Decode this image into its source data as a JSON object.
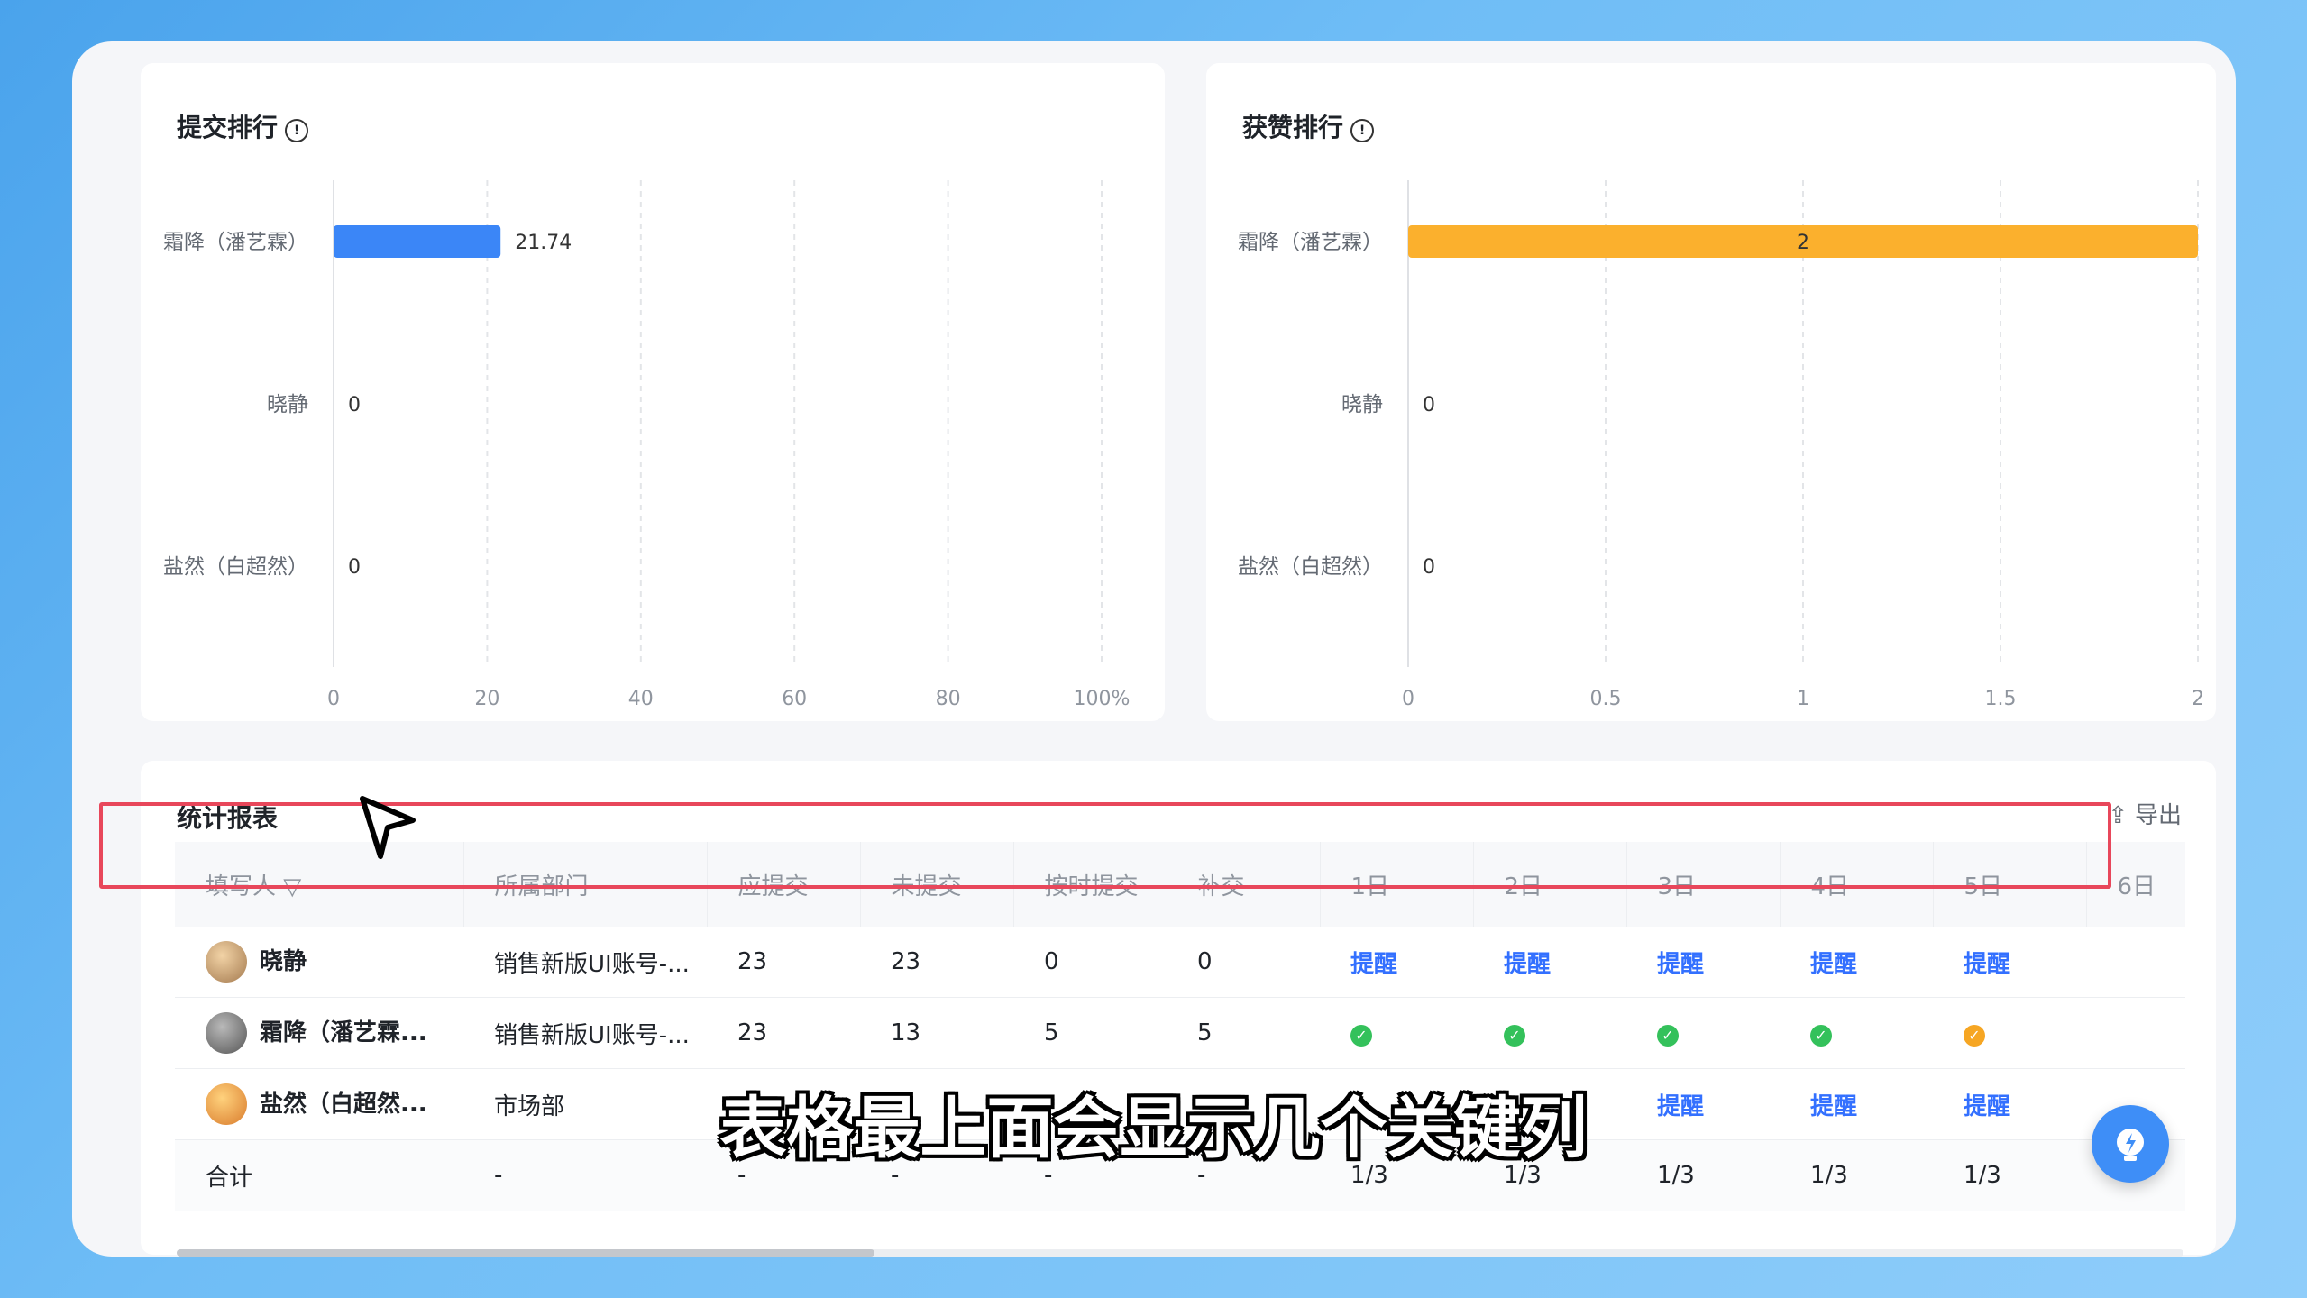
{
  "left_chart": {
    "title": "提交排行",
    "info": "!",
    "chart_data": {
      "type": "bar",
      "orientation": "horizontal",
      "categories": [
        "霜降（潘艺霖）",
        "晓静",
        "盐然（白超然）"
      ],
      "values": [
        21.74,
        0,
        0
      ],
      "value_labels": [
        "21.74",
        "0",
        "0"
      ],
      "xlim": [
        0,
        100
      ],
      "xticks": [
        "0",
        "20",
        "40",
        "60",
        "80",
        "100%"
      ],
      "color": "#3b86f7",
      "grid": "vertical-dashed"
    }
  },
  "right_chart": {
    "title": "获赞排行",
    "info": "!",
    "chart_data": {
      "type": "bar",
      "orientation": "horizontal",
      "categories": [
        "霜降（潘艺霖）",
        "晓静",
        "盐然（白超然）"
      ],
      "values": [
        2,
        0,
        0
      ],
      "value_labels": [
        "2",
        "0",
        "0"
      ],
      "xlim": [
        0,
        2
      ],
      "xticks": [
        "0",
        "0.5",
        "1",
        "1.5",
        "2"
      ],
      "color": "#fbb02d",
      "grid": "vertical-dashed"
    }
  },
  "report": {
    "title": "统计报表",
    "export_label": "导出",
    "headers": [
      "填写人",
      "所属部门",
      "应提交",
      "未提交",
      "按时提交",
      "补交",
      "1日",
      "2日",
      "3日",
      "4日",
      "5日",
      "6日"
    ],
    "rows": [
      {
        "name": "晓静",
        "dept": "销售新版UI账号-...",
        "should": "23",
        "missing": "23",
        "ontime": "0",
        "late": "0",
        "days": [
          "提醒",
          "提醒",
          "提醒",
          "提醒",
          "提醒",
          ""
        ]
      },
      {
        "name": "霜降（潘艺霖...",
        "dept": "销售新版UI账号-...",
        "should": "23",
        "missing": "13",
        "ontime": "5",
        "late": "5",
        "days": [
          "ok",
          "ok",
          "ok",
          "ok",
          "ok-orange",
          ""
        ]
      },
      {
        "name": "盐然（白超然...",
        "dept": "市场部",
        "should": "",
        "missing": "",
        "ontime": "",
        "late": "",
        "days": [
          "",
          "",
          "提醒",
          "提醒",
          "提醒",
          ""
        ]
      }
    ],
    "total": {
      "label": "合计",
      "dept": "-",
      "should": "-",
      "missing": "-",
      "ontime": "-",
      "late": "-",
      "days": [
        "1/3",
        "1/3",
        "1/3",
        "1/3",
        "1/3",
        ""
      ]
    }
  },
  "subtitle": "表格最上面会显示几个关键列",
  "fab_icon": "lightbulb-icon"
}
